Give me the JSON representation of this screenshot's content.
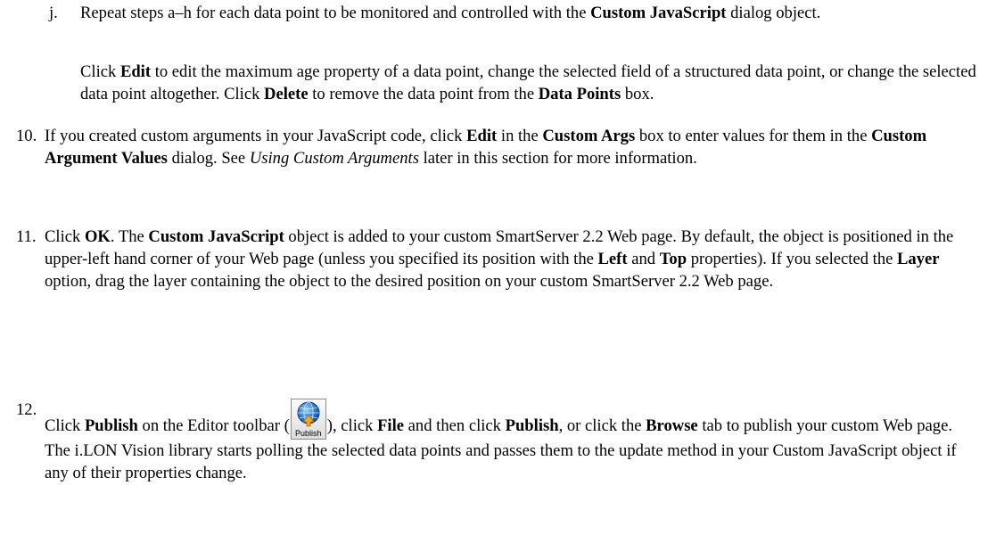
{
  "item_j": {
    "marker": "j.",
    "p1": "Repeat steps a–h for each data point to be monitored and controlled with the ",
    "b1": "Custom JavaScript",
    "p2": " dialog object.",
    "c1": "Click ",
    "c_b1": "Edit",
    "c2": " to edit the maximum age property of a data point, change the selected field of a structured data point, or change the selected data point altogether.  Click ",
    "c_b2": "Delete",
    "c3": " to remove the data point from the ",
    "c_b3": "Data Points",
    "c4": " box."
  },
  "item_10": {
    "marker": "10.",
    "p1": "If you created custom arguments in your JavaScript code, click ",
    "b1": "Edit",
    "p2": " in the ",
    "b2": "Custom Args",
    "p3": " box to enter values for them in the ",
    "b3": "Custom Argument Values",
    "p4": " dialog.  See ",
    "i1": "Using Custom Arguments",
    "p5": " later in this section for more information."
  },
  "item_11": {
    "marker": "11.",
    "p1": "Click ",
    "b1": "OK",
    "p2": ".  The ",
    "b2": "Custom JavaScript",
    "p3": " object is added to your custom SmartServer 2.2 Web page.  By default, the object is positioned in the upper-left hand corner of your Web page (unless you specified its position with the ",
    "b3": "Left",
    "p4": " and ",
    "b4": "Top",
    "p5": " properties).  If you selected the ",
    "b5": "Layer",
    "p6": " option, drag the layer containing the object to the desired position on your custom SmartServer 2.2 Web page."
  },
  "item_12": {
    "marker": "12.",
    "p1": "Click ",
    "b1": "Publish",
    "p2": " on the Editor toolbar (",
    "icon_label": "Publish",
    "p3": "), click ",
    "b2": "File",
    "p4": " and then click ",
    "b3": "Publish",
    "p5": ", or click the ",
    "b4": "Browse",
    "p6": " tab to publish your custom Web page.   The i.LON Vision library starts polling the selected data points and passes them to the update method in your Custom JavaScript object if any of their properties change.",
    "icon": "publish-globe-icon"
  }
}
